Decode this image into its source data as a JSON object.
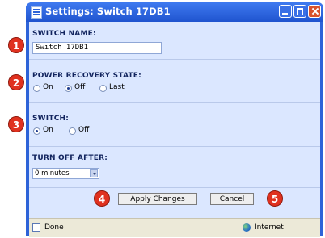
{
  "window": {
    "title": "Settings: Switch 17DB1"
  },
  "switch_name": {
    "label": "SWITCH NAME:",
    "value": "Switch 17DB1"
  },
  "power_recovery": {
    "label": "POWER RECOVERY STATE:",
    "options": [
      "On",
      "Off",
      "Last"
    ],
    "selected": "Off"
  },
  "switch_state": {
    "label": "SWITCH:",
    "options": [
      "On",
      "Off"
    ],
    "selected": "On"
  },
  "turn_off_after": {
    "label": "TURN OFF AFTER:",
    "value": "0 minutes"
  },
  "buttons": {
    "apply": "Apply Changes",
    "cancel": "Cancel"
  },
  "statusbar": {
    "left": "Done",
    "zone": "Internet"
  },
  "callouts": [
    "1",
    "2",
    "3",
    "4",
    "5"
  ],
  "colors": {
    "callout": "#e0311f",
    "title_bar": "#2d63d8",
    "panel": "#dbe7ff"
  }
}
